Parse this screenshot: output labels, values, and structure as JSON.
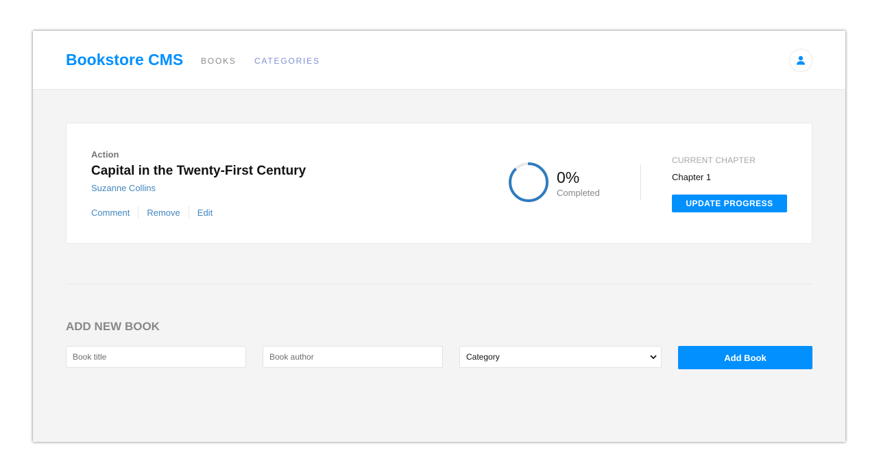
{
  "header": {
    "brand": "Bookstore CMS",
    "nav": [
      {
        "label": "BOOKS"
      },
      {
        "label": "CATEGORIES"
      }
    ],
    "user_icon": "user-icon"
  },
  "books": [
    {
      "genre": "Action",
      "title": "Capital in the Twenty-First Century",
      "author": "Suzanne Collins",
      "actions": [
        "Comment",
        "Remove",
        "Edit"
      ],
      "progress_percent": 0,
      "percent_label": "0%",
      "completed_label": "Completed",
      "current_chapter_heading": "CURRENT CHAPTER",
      "current_chapter": "Chapter 1",
      "update_button": "UPDATE PROGRESS"
    }
  ],
  "add_form": {
    "heading": "ADD NEW BOOK",
    "title_placeholder": "Book title",
    "author_placeholder": "Book author",
    "category_selected": "Category",
    "submit_label": "Add Book"
  },
  "colors": {
    "accent": "#0290ff",
    "link": "#4386bf",
    "background": "#f4f4f4"
  }
}
